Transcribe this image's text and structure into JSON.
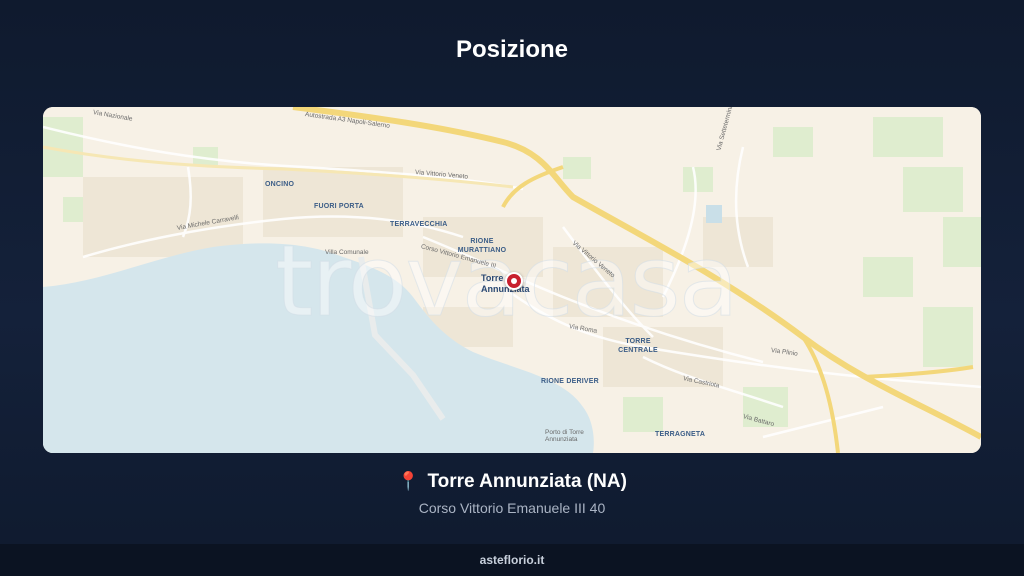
{
  "header": {
    "title": "Posizione"
  },
  "map": {
    "watermark": "trovacasa",
    "city_label": [
      "Torre",
      "Annunziata"
    ],
    "districts": [
      "ONCINO",
      "FUORI PORTA",
      "TERRAVECCHIA",
      "RIONE MURATTIANO",
      "TORRE CENTRALE",
      "RIONE DERIVER",
      "TERRAGNETA"
    ],
    "roads": [
      "Via Nazionale",
      "Autostrada A3 Napoli-Salerno",
      "Via Vittorio Veneto",
      "Via Settetermini",
      "Via Roma",
      "Via Castriota",
      "Via Plinio",
      "Via Michele Carravelli",
      "Corso Vittorio Emanuele III",
      "Via Vittorio Veneto",
      "Via Battaro",
      "Porto di Torre Annunziata",
      "Villa Comunale"
    ],
    "colors": {
      "land": "#f7f1e6",
      "water": "#d5e6ec",
      "highway": "#f3d77a",
      "park": "#dfedcf"
    }
  },
  "location": {
    "pin_icon": "📍",
    "name": "Torre Annunziata (NA)",
    "address": "Corso Vittorio Emanuele III 40"
  },
  "footer": {
    "site": "asteflorio.it"
  }
}
